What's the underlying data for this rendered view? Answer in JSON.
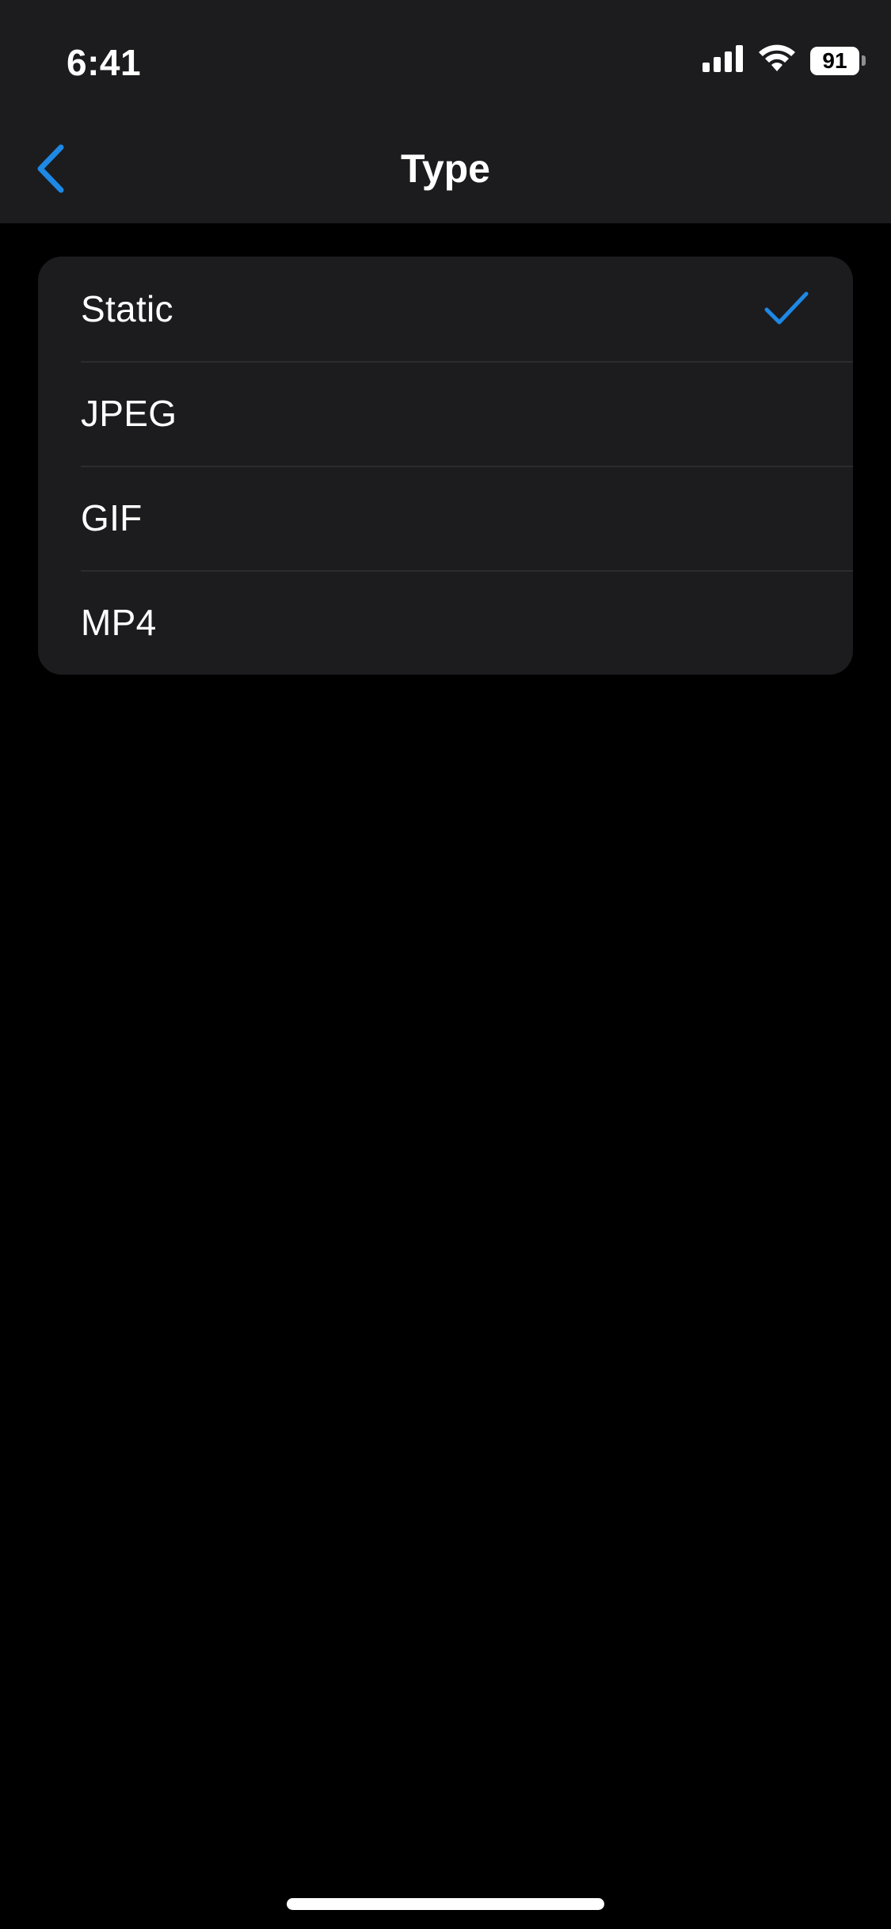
{
  "status_bar": {
    "time": "6:41",
    "battery_level": "91",
    "signal_icon": "cellular-signal-icon",
    "wifi_icon": "wifi-icon"
  },
  "nav": {
    "title": "Type",
    "back_icon": "chevron-left-icon"
  },
  "options": [
    {
      "label": "Static",
      "selected": true
    },
    {
      "label": "JPEG",
      "selected": false
    },
    {
      "label": "GIF",
      "selected": false
    },
    {
      "label": "MP4",
      "selected": false
    }
  ],
  "colors": {
    "accent": "#1e88e5",
    "background": "#000000",
    "card": "#1c1c1e",
    "separator": "#2c2c2e"
  }
}
